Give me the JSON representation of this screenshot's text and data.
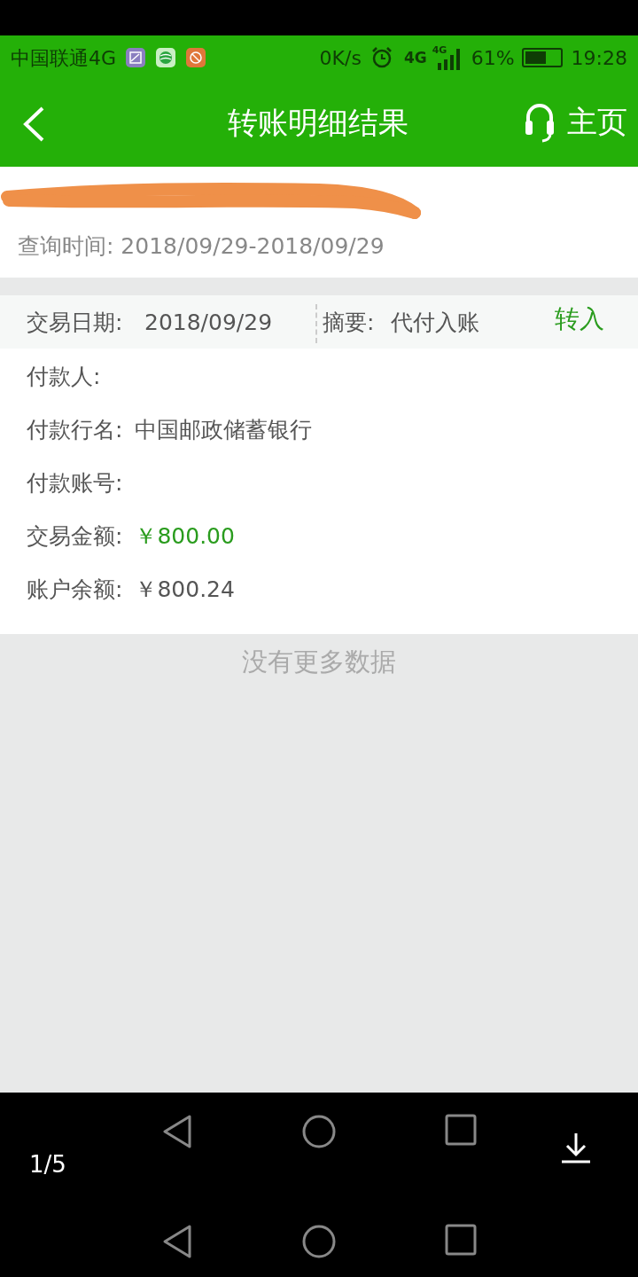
{
  "status_bar": {
    "carrier": "中国联通4G",
    "speed": "0K/s",
    "network": "4G",
    "signal_network": "4G",
    "battery_percent": "61%",
    "time": "19:28"
  },
  "header": {
    "title": "转账明细结果",
    "home": "主页"
  },
  "query": {
    "time": "查询时间: 2018/09/29-2018/09/29"
  },
  "record": {
    "date_label": "交易日期:",
    "date": "2018/09/29",
    "summary_label": "摘要:",
    "summary": "代付入账",
    "direction": "转入",
    "fields": [
      {
        "label": "付款人:"
      },
      {
        "label": "付款行名:",
        "value": "中国邮政储蓄银行",
        "kind": "plain"
      },
      {
        "label": "付款账号:"
      },
      {
        "label": "交易金额:",
        "value": "￥800.00",
        "kind": "amount"
      },
      {
        "label": "账户余额:",
        "value": "￥800.24",
        "kind": "plain"
      }
    ]
  },
  "footer": {
    "message": "没有更多数据"
  },
  "viewer": {
    "page": "1/5"
  }
}
